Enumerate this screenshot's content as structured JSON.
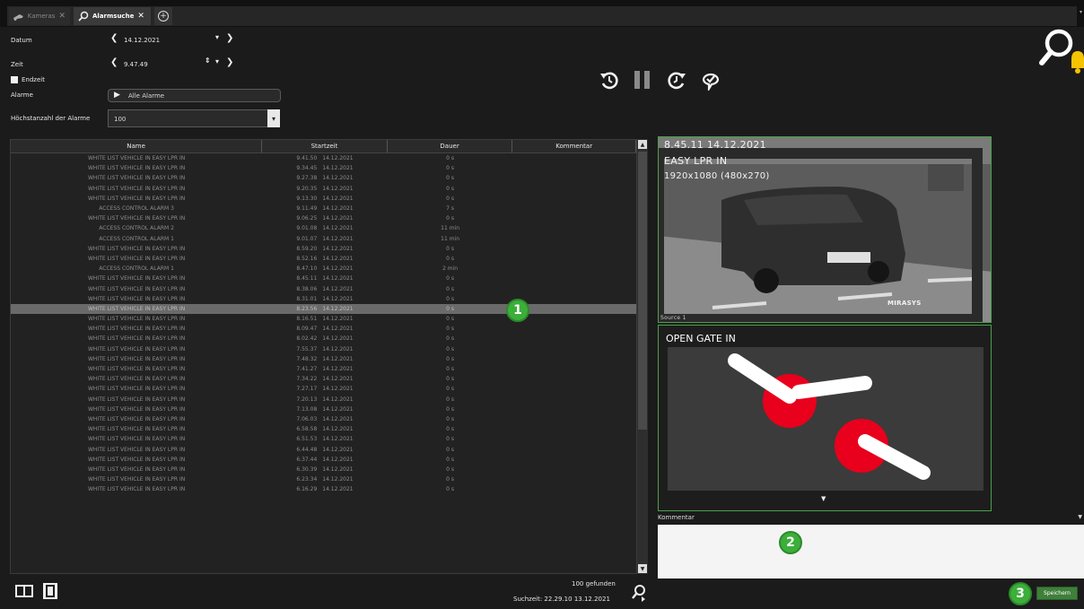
{
  "tabs": [
    {
      "label": "Kameras",
      "close": "✕"
    },
    {
      "label": "Alarmsuche",
      "close": "✕"
    }
  ],
  "filters": {
    "date_label": "Datum",
    "date_value": "14.12.2021",
    "time_label": "Zeit",
    "time_value": "9.47.49",
    "endtime_label": "Endzeit",
    "alarms_label": "Alarme",
    "alarms_value": "Alle Alarme",
    "maxcount_label": "Höchstanzahl der Alarme",
    "maxcount_value": "100"
  },
  "table": {
    "headers": [
      "Name",
      "Startzeit",
      "Dauer",
      "Kommentar"
    ],
    "selected_index": 15,
    "rows": [
      [
        "WHITE LIST VEHICLE IN EASY LPR IN",
        "9.41.50",
        "14.12.2021",
        "0 s"
      ],
      [
        "WHITE LIST VEHICLE IN EASY LPR IN",
        "9.34.45",
        "14.12.2021",
        "0 s"
      ],
      [
        "WHITE LIST VEHICLE IN EASY LPR IN",
        "9.27.38",
        "14.12.2021",
        "0 s"
      ],
      [
        "WHITE LIST VEHICLE IN EASY LPR IN",
        "9.20.35",
        "14.12.2021",
        "0 s"
      ],
      [
        "WHITE LIST VEHICLE IN EASY LPR IN",
        "9.13.30",
        "14.12.2021",
        "0 s"
      ],
      [
        "ACCESS CONTROL ALARM 3",
        "9.11.49",
        "14.12.2021",
        "7 s"
      ],
      [
        "WHITE LIST VEHICLE IN EASY LPR IN",
        "9.06.25",
        "14.12.2021",
        "0 s"
      ],
      [
        "ACCESS CONTROL ALARM 2",
        "9.01.08",
        "14.12.2021",
        "11 min"
      ],
      [
        "ACCESS CONTROL ALARM 1",
        "9.01.07",
        "14.12.2021",
        "11 min"
      ],
      [
        "WHITE LIST VEHICLE IN EASY LPR IN",
        "8.59.20",
        "14.12.2021",
        "0 s"
      ],
      [
        "WHITE LIST VEHICLE IN EASY LPR IN",
        "8.52.16",
        "14.12.2021",
        "0 s"
      ],
      [
        "ACCESS CONTROL ALARM 1",
        "8.47.10",
        "14.12.2021",
        "2 min"
      ],
      [
        "WHITE LIST VEHICLE IN EASY LPR IN",
        "8.45.11",
        "14.12.2021",
        "0 s"
      ],
      [
        "WHITE LIST VEHICLE IN EASY LPR IN",
        "8.38.06",
        "14.12.2021",
        "0 s"
      ],
      [
        "WHITE LIST VEHICLE IN EASY LPR IN",
        "8.31.01",
        "14.12.2021",
        "0 s"
      ],
      [
        "WHITE LIST VEHICLE IN EASY LPR IN",
        "8.23.56",
        "14.12.2021",
        "0 s"
      ],
      [
        "WHITE LIST VEHICLE IN EASY LPR IN",
        "8.16.51",
        "14.12.2021",
        "0 s"
      ],
      [
        "WHITE LIST VEHICLE IN EASY LPR IN",
        "8.09.47",
        "14.12.2021",
        "0 s"
      ],
      [
        "WHITE LIST VEHICLE IN EASY LPR IN",
        "8.02.42",
        "14.12.2021",
        "0 s"
      ],
      [
        "WHITE LIST VEHICLE IN EASY LPR IN",
        "7.55.37",
        "14.12.2021",
        "0 s"
      ],
      [
        "WHITE LIST VEHICLE IN EASY LPR IN",
        "7.48.32",
        "14.12.2021",
        "0 s"
      ],
      [
        "WHITE LIST VEHICLE IN EASY LPR IN",
        "7.41.27",
        "14.12.2021",
        "0 s"
      ],
      [
        "WHITE LIST VEHICLE IN EASY LPR IN",
        "7.34.22",
        "14.12.2021",
        "0 s"
      ],
      [
        "WHITE LIST VEHICLE IN EASY LPR IN",
        "7.27.17",
        "14.12.2021",
        "0 s"
      ],
      [
        "WHITE LIST VEHICLE IN EASY LPR IN",
        "7.20.13",
        "14.12.2021",
        "0 s"
      ],
      [
        "WHITE LIST VEHICLE IN EASY LPR IN",
        "7.13.08",
        "14.12.2021",
        "0 s"
      ],
      [
        "WHITE LIST VEHICLE IN EASY LPR IN",
        "7.06.03",
        "14.12.2021",
        "0 s"
      ],
      [
        "WHITE LIST VEHICLE IN EASY LPR IN",
        "6.58.58",
        "14.12.2021",
        "0 s"
      ],
      [
        "WHITE LIST VEHICLE IN EASY LPR IN",
        "6.51.53",
        "14.12.2021",
        "0 s"
      ],
      [
        "WHITE LIST VEHICLE IN EASY LPR IN",
        "6.44.48",
        "14.12.2021",
        "0 s"
      ],
      [
        "WHITE LIST VEHICLE IN EASY LPR IN",
        "6.37.44",
        "14.12.2021",
        "0 s"
      ],
      [
        "WHITE LIST VEHICLE IN EASY LPR IN",
        "6.30.39",
        "14.12.2021",
        "0 s"
      ],
      [
        "WHITE LIST VEHICLE IN EASY LPR IN",
        "6.23.34",
        "14.12.2021",
        "0 s"
      ],
      [
        "WHITE LIST VEHICLE IN EASY LPR IN",
        "6.16.29",
        "14.12.2021",
        "0 s"
      ]
    ]
  },
  "video": {
    "overlay_time": "8.45.11 14.12.2021",
    "overlay_camera": "EASY LPR IN",
    "overlay_resolution": "1920x1080 (480x270)",
    "brand": "MIRASYS",
    "source_label": "Source 1"
  },
  "gate": {
    "title": "OPEN GATE IN"
  },
  "comment": {
    "label": "Kommentar"
  },
  "save_label": "Speichern",
  "footer": {
    "found": "100 gefunden",
    "search_time": "Suchzeit: 22.29.10  13.12.2021"
  },
  "badges": [
    "1",
    "2",
    "3"
  ],
  "colors": {
    "accent_green": "#3cae3a",
    "gate_red": "#e8001c",
    "notification": "#f5c400"
  },
  "icons": [
    "camera-icon",
    "alarm-search-icon",
    "add-tab-icon",
    "rewind-icon",
    "pause-icon",
    "forward-icon",
    "alarm-ack-icon",
    "search-icon",
    "bell-icon",
    "split-view-icon",
    "single-view-icon"
  ]
}
